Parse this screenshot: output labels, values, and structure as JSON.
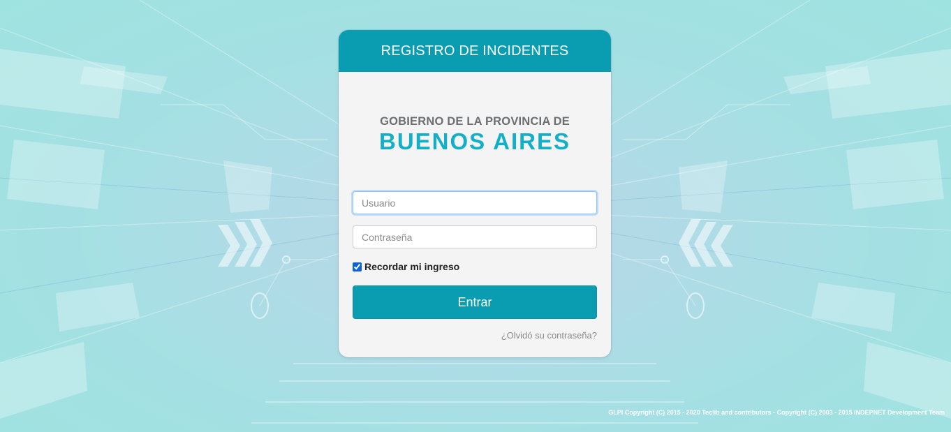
{
  "header": {
    "title": "REGISTRO DE INCIDENTES"
  },
  "logo": {
    "line1": "GOBIERNO DE LA PROVINCIA DE",
    "line2": "BUENOS AIRES"
  },
  "form": {
    "username_placeholder": "Usuario",
    "username_value": "",
    "password_placeholder": "Contraseña",
    "password_value": "",
    "remember_label": "Recordar mi ingreso",
    "remember_checked": true,
    "submit_label": "Entrar",
    "forgot_label": "¿Olvidó su contraseña?"
  },
  "footer": {
    "copyright": "GLPI Copyright (C) 2015 - 2020 Teclib and contributors - Copyright (C) 2003 - 2015 INDEPNET Development Team"
  },
  "colors": {
    "accent": "#0a9db1",
    "logo_blue": "#13afc7",
    "logo_gray": "#6d6e70"
  }
}
